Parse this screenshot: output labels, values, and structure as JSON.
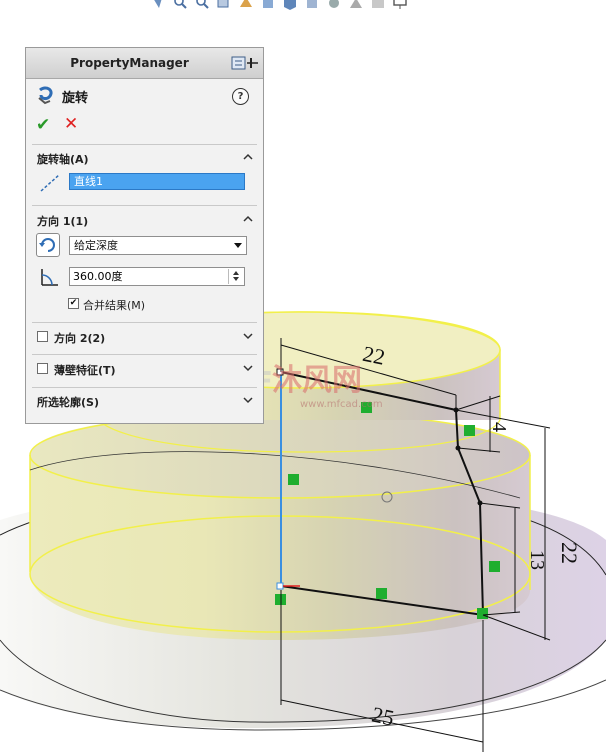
{
  "toolbar": {
    "icons": [
      "view-orientation-icon",
      "zoom-fit-icon",
      "zoom-area-icon",
      "previous-view-icon",
      "section-view-icon",
      "view-dynamic-icon",
      "display-style-icon",
      "hide-show-icon",
      "edit-appearance-icon",
      "apply-scene-icon",
      "view-settings-icon",
      "monitor-icon"
    ]
  },
  "property_manager": {
    "header_title": "PropertyManager",
    "feature_name": "旋转",
    "help_label": "?",
    "ok_label": "✔",
    "cancel_label": "✕",
    "axis_section": {
      "title": "旋转轴(A)",
      "axis_value": "直线1"
    },
    "direction1": {
      "title": "方向 1(1)",
      "end_condition": "给定深度",
      "angle_value": "360.00度",
      "merge_checked": true,
      "merge_label": "合并结果(M)"
    },
    "direction2": {
      "title": "方向 2(2)",
      "checked": false
    },
    "thin_feature": {
      "title": "薄壁特征(T)",
      "checked": false
    },
    "selected_contours": {
      "title": "所选轮廓(S)"
    }
  },
  "dimensions": {
    "top_width": "22",
    "step_height": "4",
    "total_height": "22",
    "lower_height": "13",
    "base_width": "25"
  },
  "watermark": {
    "main": "沐风网",
    "sub": "www.mfcad.com",
    "logo": "MF"
  },
  "colors": {
    "highlight_yellow": "#f2f04a",
    "sketch_blue": "#3a8fe0",
    "relation_green": "#1fae2f"
  }
}
